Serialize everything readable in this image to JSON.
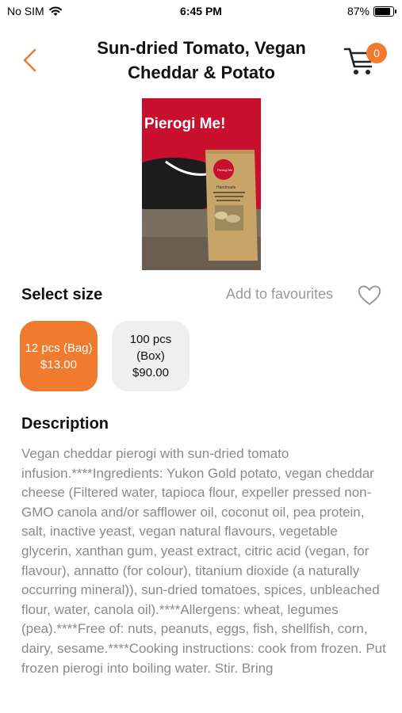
{
  "status_bar": {
    "carrier": "No SIM",
    "time": "6:45 PM",
    "battery": "87%",
    "battery_level": 0.87
  },
  "header": {
    "title": "Sun-dried Tomato, Vegan Cheddar & Potato",
    "cart_count": "0"
  },
  "product": {
    "image_brand_text": "Pierogi Me!",
    "image_bag_text": "Handmade"
  },
  "size_section": {
    "title": "Select size",
    "favourites_label": "Add to favourites",
    "options": [
      {
        "label": "12 pcs (Bag)",
        "price": "$13.00",
        "selected": true
      },
      {
        "label": "100 pcs (Box)",
        "price": "$90.00",
        "selected": false
      }
    ]
  },
  "description": {
    "title": "Description",
    "text": "Vegan cheddar pierogi with sun-dried tomato infusion.****Ingredients: Yukon Gold potato, vegan cheddar cheese (Filtered water, tapioca flour, expeller pressed non-GMO canola and/or safflower oil, coconut oil, pea protein, salt, inactive yeast, vegan natural flavours, vegetable glycerin, xanthan gum, yeast extract, citric acid (vegan, for flavour), annatto (for colour), titanium dioxide (a naturally occurring mineral)), sun-dried tomatoes, spices, unbleached flour, water, canola oil).****Allergens: wheat, legumes (pea).****Free of: nuts, peanuts, eggs, fish, shellfish, corn, dairy, sesame.****Cooking instructions: cook from frozen. Put frozen pierogi into boiling water. Stir. Bring"
  },
  "colors": {
    "accent": "#f07a2e",
    "muted_text": "#8a8a8a",
    "option_bg": "#efefef"
  },
  "icons": {
    "back": "chevron-left-icon",
    "cart": "cart-icon",
    "favourite": "heart-icon",
    "wifi": "wifi-icon",
    "battery": "battery-icon"
  }
}
